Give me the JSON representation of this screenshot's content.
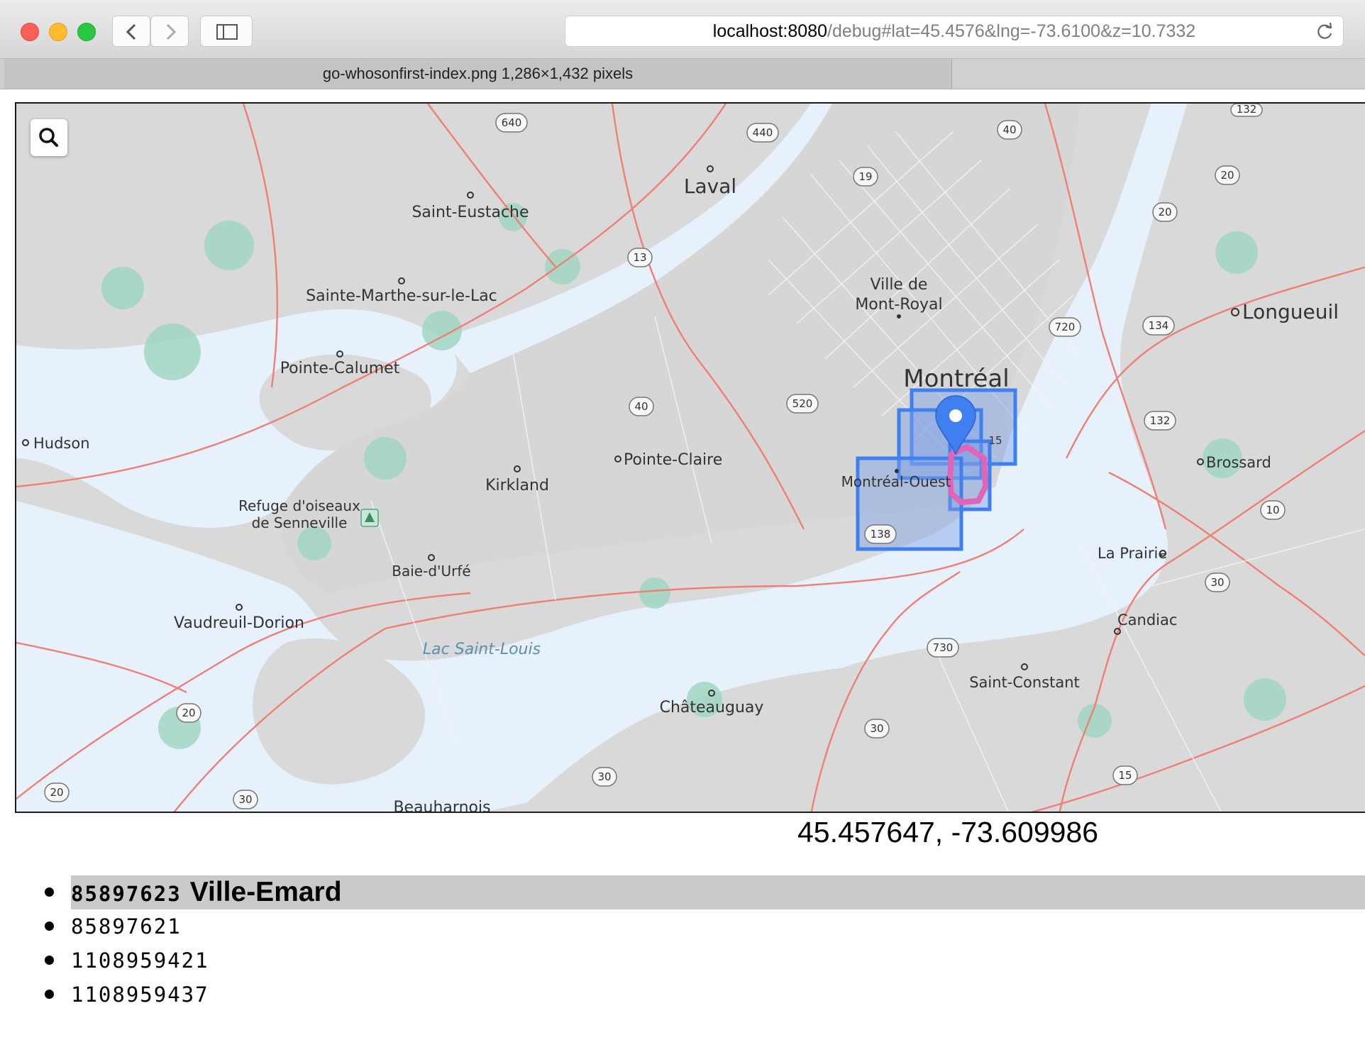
{
  "browser": {
    "url_host": "localhost:8080",
    "url_path": "/debug#lat=45.4576&lng=-73.6100&z=10.7332",
    "tab_title": "go-whosonfirst-index.png 1,286×1,432 pixels"
  },
  "map": {
    "search_icon": "search-icon",
    "places": {
      "laval": "Laval",
      "saint_eustache": "Saint-Eustache",
      "sainte_marthe": "Sainte-Marthe-sur-le-Lac",
      "pointe_calumet": "Pointe-Calumet",
      "hudson": "Hudson",
      "kirkland": "Kirkland",
      "pointe_claire": "Pointe-Claire",
      "refuge_line1": "Refuge d'oiseaux",
      "refuge_line2": "de Senneville",
      "baie_durfe": "Baie-d'Urfé",
      "vaudreuil": "Vaudreuil-Dorion",
      "lac_saint_louis": "Lac Saint-Louis",
      "chateauguay": "Châteauguay",
      "beauharnois": "Beauharnois",
      "mont_royal_line1": "Ville de",
      "mont_royal_line2": "Mont-Royal",
      "montreal": "Montréal",
      "montreal_ouest": "Montréal-Ouest",
      "longueuil": "Longueuil",
      "brossard": "Brossard",
      "la_prairie": "La Prairie",
      "candiac": "Candiac",
      "saint_constant": "Saint-Constant"
    },
    "shields": {
      "r640": "640",
      "r440": "440",
      "r40a": "40",
      "r19": "19",
      "r20a": "20",
      "r20b": "20",
      "r13": "13",
      "r720": "720",
      "r134": "134",
      "r132a": "132",
      "r132b": "132",
      "r40b": "40",
      "r520": "520",
      "r138": "138",
      "r15a": "15",
      "r10": "10",
      "r30a": "30",
      "r730": "730",
      "r30b": "30",
      "r30c": "30",
      "r15b": "15",
      "r20c": "20",
      "r20d": "20",
      "r30d": "30"
    }
  },
  "coordinates": "45.457647, -73.609986",
  "results": [
    {
      "id": "85897623",
      "name": "Ville-Emard",
      "highlighted": true
    },
    {
      "id": "85897621",
      "name": "",
      "highlighted": false
    },
    {
      "id": "1108959421",
      "name": "",
      "highlighted": false
    },
    {
      "id": "1108959437",
      "name": "",
      "highlighted": false
    }
  ],
  "colors": {
    "water": "#e6f1fb",
    "land": "#d9d9d9",
    "road": "#ef7f74",
    "bbox": "#3f7ff0",
    "polygon": "#e064b7",
    "marker": "#3f7ff0"
  }
}
